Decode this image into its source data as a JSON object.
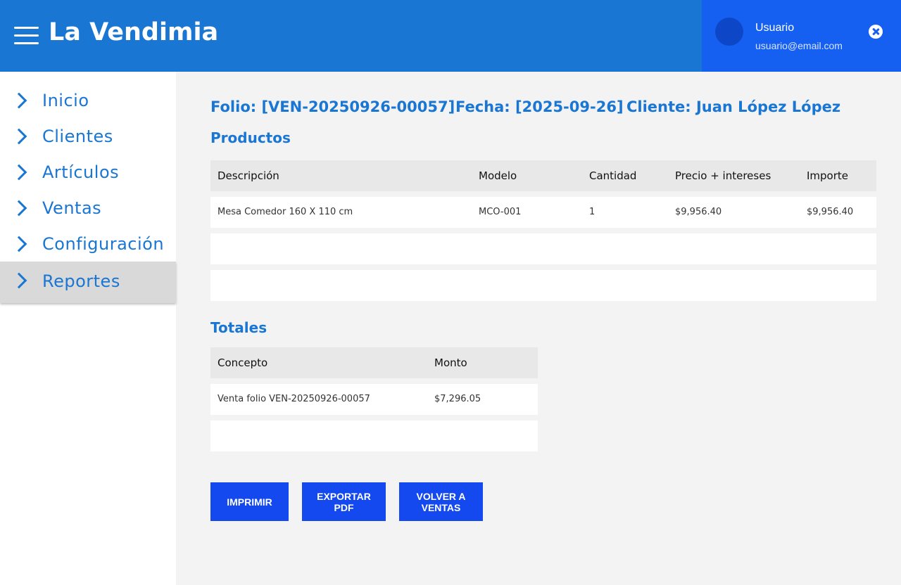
{
  "header": {
    "title": "La Vendimia",
    "user": {
      "name": "Usuario",
      "email": "usuario@email.com"
    }
  },
  "sidebar": {
    "items": [
      {
        "label": "Inicio"
      },
      {
        "label": "Clientes"
      },
      {
        "label": "Artículos"
      },
      {
        "label": "Ventas"
      },
      {
        "label": "Configuración"
      },
      {
        "label": "Reportes",
        "active": true
      }
    ]
  },
  "sale": {
    "folio": "Folio: [VEN-20250926-00057]",
    "fecha": "Fecha: [2025-09-26]",
    "cliente": "Cliente: Juan López López"
  },
  "products": {
    "title": "Productos",
    "columns": [
      "Descripción",
      "Modelo",
      "Cantidad",
      "Precio + intereses",
      "Importe"
    ],
    "rows": [
      [
        "Mesa Comedor 160 X 110 cm",
        "MCO-001",
        "1",
        "$9,956.40",
        "$9,956.40"
      ]
    ]
  },
  "totals": {
    "title": "Totales",
    "columns": [
      "Concepto",
      "Monto"
    ],
    "rows": [
      [
        "Venta folio VEN-20250926-00057",
        "$7,296.05"
      ]
    ]
  },
  "actions": {
    "print": "IMPRIMIR",
    "export_pdf": "EXPORTAR PDF",
    "back": "VOLVER A VENTAS"
  },
  "colors": {
    "header": "#1976d2",
    "user_panel": "#1560f0",
    "accent": "#1976d2",
    "button": "#1449f0"
  }
}
